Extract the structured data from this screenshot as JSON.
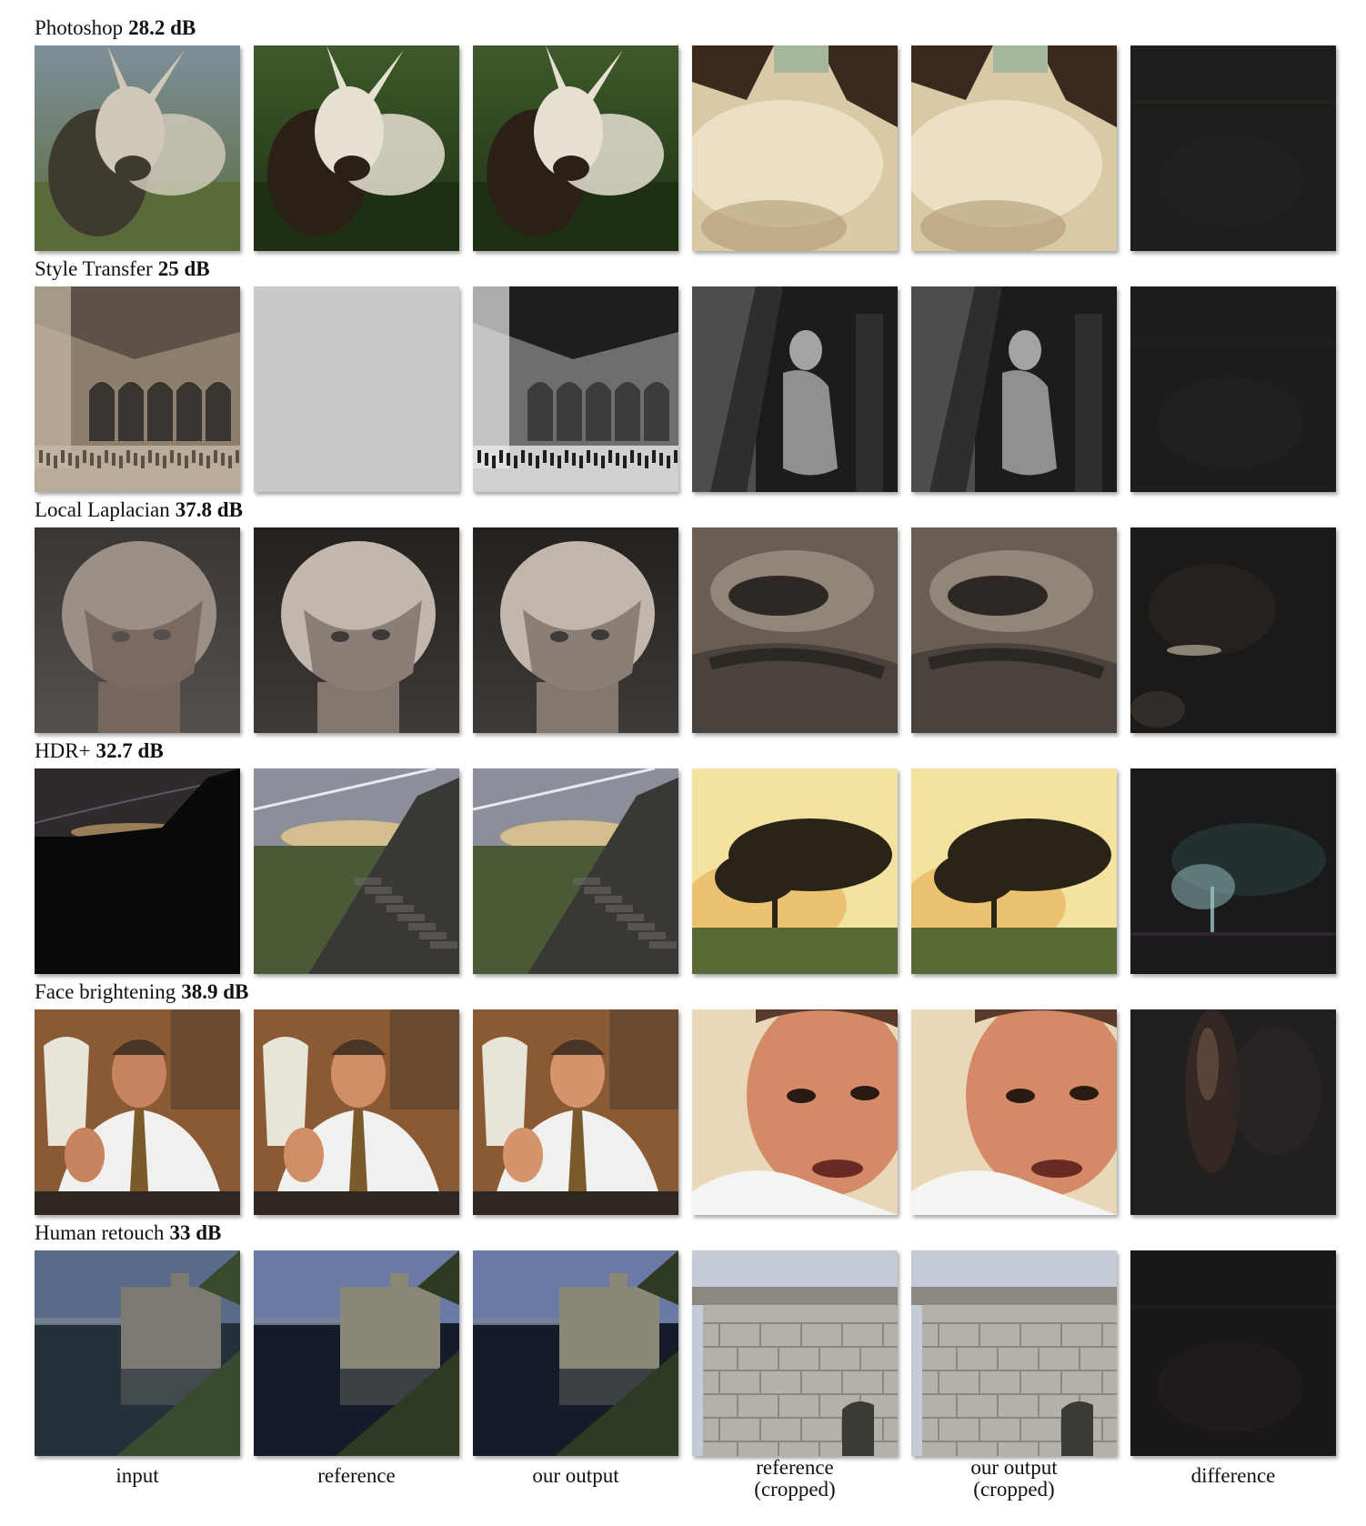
{
  "rows": [
    {
      "title": "Photoshop",
      "score": "28.2 dB",
      "tiles": [
        {
          "subject": "donkey-in-field",
          "palette": [
            "#5a6b3a",
            "#3e3a30",
            "#cfc8b8",
            "#7f8f9a"
          ]
        },
        {
          "subject": "donkey-in-field",
          "palette": [
            "#1e2f12",
            "#2a2018",
            "#e6e0d2",
            "#3e5a2a"
          ]
        },
        {
          "subject": "donkey-in-field",
          "palette": [
            "#1e2f12",
            "#2a2018",
            "#e6e0d2",
            "#3e5a2a"
          ]
        },
        {
          "subject": "fur-closeup",
          "palette": [
            "#d9c9a5",
            "#3a2a1e",
            "#f0e6cc",
            "#a4b79a"
          ]
        },
        {
          "subject": "fur-closeup",
          "palette": [
            "#d9c9a5",
            "#3a2a1e",
            "#f0e6cc",
            "#a4b79a"
          ]
        },
        {
          "subject": "difference-map",
          "palette": [
            "#201e1c",
            "#2a2622",
            "#262320",
            "#2c2824"
          ]
        }
      ]
    },
    {
      "title": "Style Transfer",
      "score": "25 dB",
      "tiles": [
        {
          "subject": "cathedral-interior",
          "palette": [
            "#8c7f6c",
            "#5c5248",
            "#c4b8a4",
            "#3a3430"
          ]
        },
        {
          "subject": "blank-gray",
          "palette": [
            "#c8c9cb",
            "#c8c9cb",
            "#c8c9cb",
            "#c8c9cb"
          ]
        },
        {
          "subject": "cathedral-interior-bw",
          "palette": [
            "#6e6e6e",
            "#1e1e1e",
            "#e8e8e8",
            "#3c3c3c"
          ]
        },
        {
          "subject": "statue-closeup",
          "palette": [
            "#1c1c1c",
            "#5a5a5a",
            "#a4a4a4",
            "#2e2e2e"
          ]
        },
        {
          "subject": "statue-closeup",
          "palette": [
            "#1c1c1c",
            "#5a5a5a",
            "#a4a4a4",
            "#2e2e2e"
          ]
        },
        {
          "subject": "difference-map",
          "palette": [
            "#1e1c1c",
            "#242222",
            "#211f1f",
            "#282626"
          ]
        }
      ]
    },
    {
      "title": "Local Laplacian",
      "score": "37.8 dB",
      "tiles": [
        {
          "subject": "stone-head",
          "palette": [
            "#54504e",
            "#7a6a62",
            "#9c8f86",
            "#3a3634"
          ]
        },
        {
          "subject": "stone-head",
          "palette": [
            "#3e3a38",
            "#8a7e76",
            "#c2b7ac",
            "#24201e"
          ]
        },
        {
          "subject": "stone-head",
          "palette": [
            "#3e3a38",
            "#8a7e76",
            "#c2b7ac",
            "#24201e"
          ]
        },
        {
          "subject": "stone-closeup",
          "palette": [
            "#6a5e54",
            "#2e2824",
            "#a4968a",
            "#4a423c"
          ]
        },
        {
          "subject": "stone-closeup",
          "palette": [
            "#6a5e54",
            "#2e2824",
            "#a4968a",
            "#4a423c"
          ]
        },
        {
          "subject": "difference-map-glow",
          "palette": [
            "#1c1a18",
            "#2c2620",
            "#8a8476",
            "#3a342e"
          ]
        }
      ]
    },
    {
      "title": "HDR+",
      "score": "32.7 dB",
      "tiles": [
        {
          "subject": "dark-sunset",
          "palette": [
            "#060606",
            "#2e2a2e",
            "#c9a36a",
            "#0a0a0a"
          ]
        },
        {
          "subject": "sunset-hillside",
          "palette": [
            "#8c8f9a",
            "#3a3834",
            "#e7c98a",
            "#4a5a36"
          ]
        },
        {
          "subject": "sunset-hillside",
          "palette": [
            "#8c8f9a",
            "#3a3834",
            "#e7c98a",
            "#4a5a36"
          ]
        },
        {
          "subject": "tree-sunset",
          "palette": [
            "#f4e2a0",
            "#2a2418",
            "#e8b45a",
            "#5a6a34"
          ]
        },
        {
          "subject": "tree-sunset",
          "palette": [
            "#f4e2a0",
            "#2a2418",
            "#e8b45a",
            "#5a6a34"
          ]
        },
        {
          "subject": "difference-map-tree",
          "palette": [
            "#1a1a1a",
            "#2a3a3a",
            "#9ac4c4",
            "#3a2a3a"
          ]
        }
      ]
    },
    {
      "title": "Face brightening",
      "score": "38.9 dB",
      "tiles": [
        {
          "subject": "portrait-man",
          "palette": [
            "#8a5a34",
            "#f0f0ee",
            "#c8845e",
            "#2e2620"
          ]
        },
        {
          "subject": "portrait-man",
          "palette": [
            "#8a5a34",
            "#f0f0ee",
            "#d08e66",
            "#2e2620"
          ]
        },
        {
          "subject": "portrait-man",
          "palette": [
            "#8a5a34",
            "#f0f0ee",
            "#d4946c",
            "#2e2620"
          ]
        },
        {
          "subject": "face-closeup",
          "palette": [
            "#e8d8b8",
            "#d48a66",
            "#f4f4f2",
            "#5a3a2a"
          ]
        },
        {
          "subject": "face-closeup",
          "palette": [
            "#e8d8b8",
            "#d48a66",
            "#f4f4f2",
            "#5a3a2a"
          ]
        },
        {
          "subject": "difference-map-face",
          "palette": [
            "#22201e",
            "#3a2c26",
            "#6a5040",
            "#2a2624"
          ]
        }
      ]
    },
    {
      "title": "Human retouch",
      "score": "33 dB",
      "tiles": [
        {
          "subject": "lake-building",
          "palette": [
            "#5a6a8a",
            "#24303a",
            "#7c7a70",
            "#3a4a2e"
          ]
        },
        {
          "subject": "lake-building",
          "palette": [
            "#6a7aa4",
            "#141c2a",
            "#8a8678",
            "#2e3a22"
          ]
        },
        {
          "subject": "lake-building",
          "palette": [
            "#6a7aa4",
            "#141c2a",
            "#8a8678",
            "#2e3a22"
          ]
        },
        {
          "subject": "wall-closeup",
          "palette": [
            "#c4cad6",
            "#b4b2a8",
            "#8a8880",
            "#3a3a36"
          ]
        },
        {
          "subject": "wall-closeup",
          "palette": [
            "#c4cad6",
            "#b4b2a8",
            "#8a8880",
            "#3a3a36"
          ]
        },
        {
          "subject": "difference-map",
          "palette": [
            "#1a1816",
            "#242020",
            "#1e1c1a",
            "#2a2624"
          ]
        }
      ]
    }
  ],
  "columns": [
    {
      "label": "input"
    },
    {
      "label": "reference"
    },
    {
      "label": "our output"
    },
    {
      "label": "reference",
      "label2": "(cropped)"
    },
    {
      "label": "our output",
      "label2": "(cropped)"
    },
    {
      "label": "difference"
    }
  ]
}
